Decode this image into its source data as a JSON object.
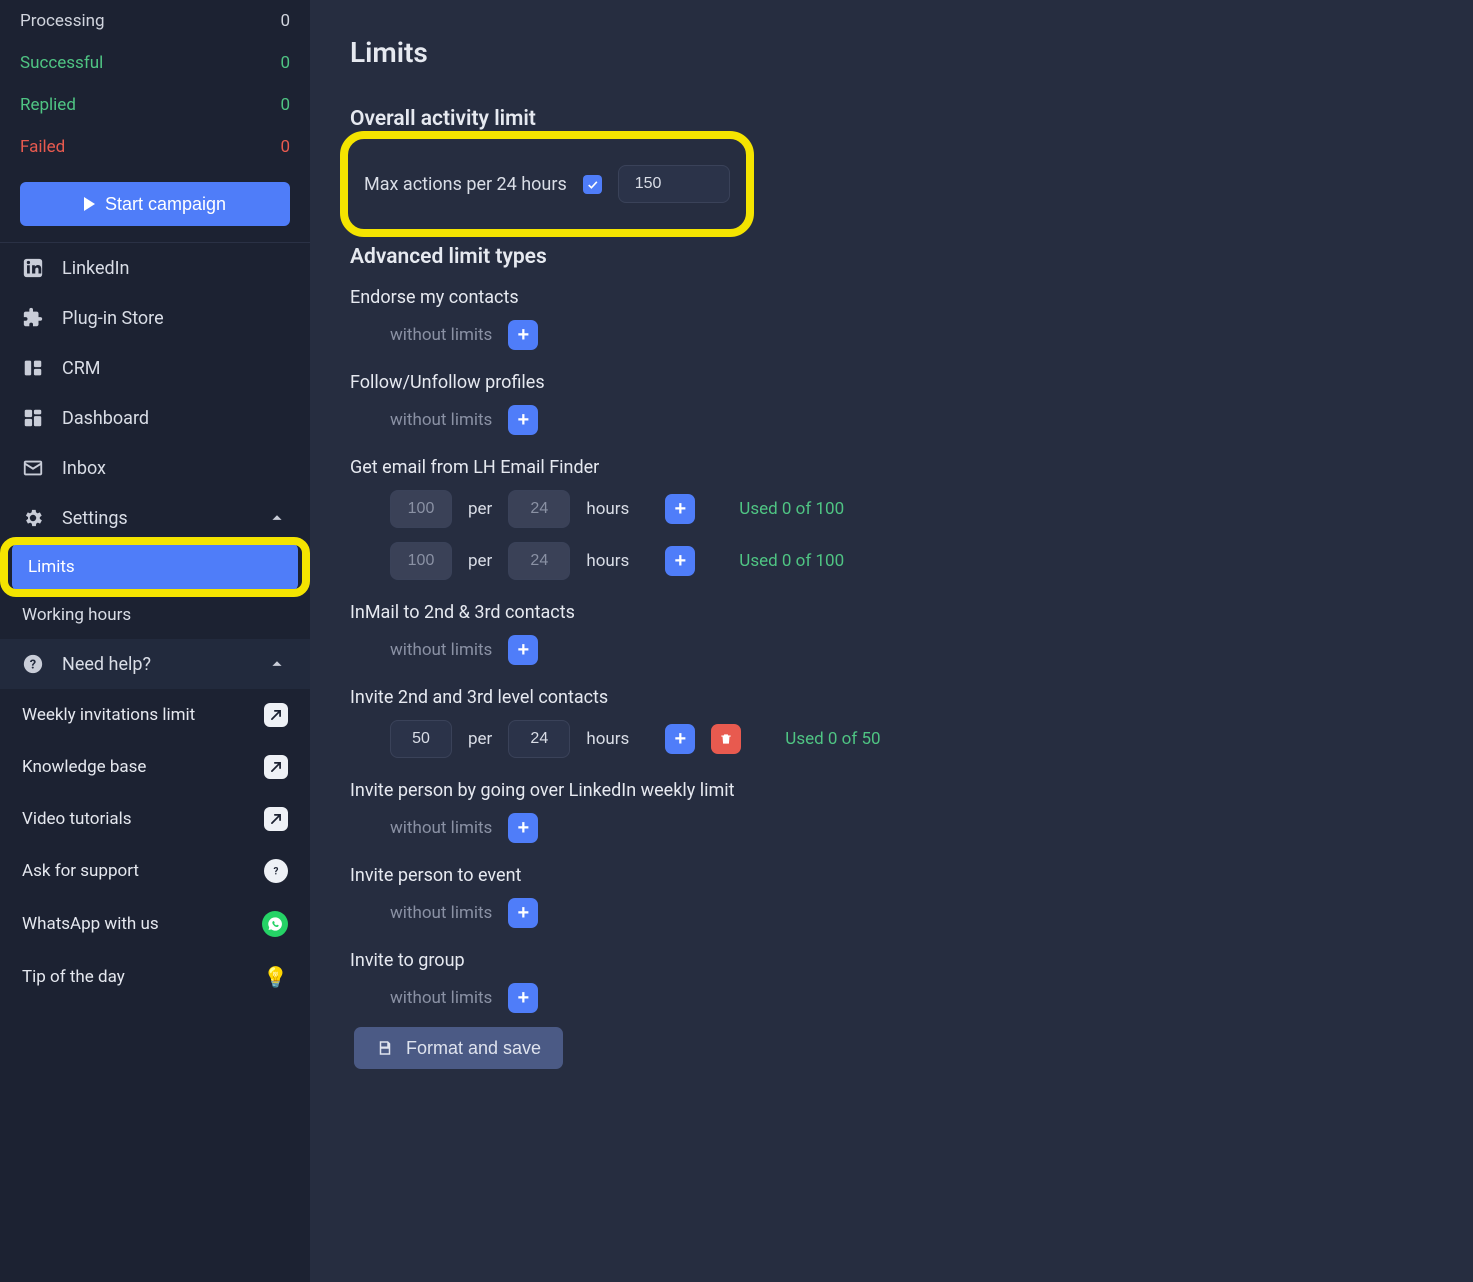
{
  "sidebar": {
    "stats": {
      "processing": {
        "label": "Processing",
        "value": "0"
      },
      "successful": {
        "label": "Successful",
        "value": "0"
      },
      "replied": {
        "label": "Replied",
        "value": "0"
      },
      "failed": {
        "label": "Failed",
        "value": "0"
      }
    },
    "start_label": "Start campaign",
    "nav": {
      "linkedin": "LinkedIn",
      "plugin": "Plug-in Store",
      "crm": "CRM",
      "dashboard": "Dashboard",
      "inbox": "Inbox",
      "settings": "Settings",
      "limits": "Limits",
      "working": "Working hours"
    },
    "help": {
      "title": "Need help?",
      "weekly": "Weekly invitations limit",
      "kb": "Knowledge base",
      "video": "Video tutorials",
      "ask": "Ask for support",
      "wa": "WhatsApp with us",
      "tip": "Tip of the day"
    }
  },
  "page": {
    "title": "Limits",
    "overall_heading": "Overall activity limit",
    "overall_label": "Max actions per 24 hours",
    "overall_value": "150",
    "advanced_heading": "Advanced limit types",
    "without_limits": "without limits",
    "per": "per",
    "hours": "hours",
    "groups": {
      "endorse": "Endorse my contacts",
      "follow": "Follow/Unfollow profiles",
      "email": "Get email from LH Email Finder",
      "email_r1": {
        "n": "100",
        "per": "24",
        "used": "Used 0 of 100"
      },
      "email_r2": {
        "n": "100",
        "per": "24",
        "used": "Used 0 of 100"
      },
      "inmail": "InMail to 2nd & 3rd contacts",
      "invite23": "Invite 2nd and 3rd level contacts",
      "invite23_r": {
        "n": "50",
        "per": "24",
        "used": "Used 0 of 50"
      },
      "invite_over": "Invite person by going over LinkedIn weekly limit",
      "invite_event": "Invite person to event",
      "invite_group": "Invite to group"
    },
    "save": "Format and save"
  }
}
